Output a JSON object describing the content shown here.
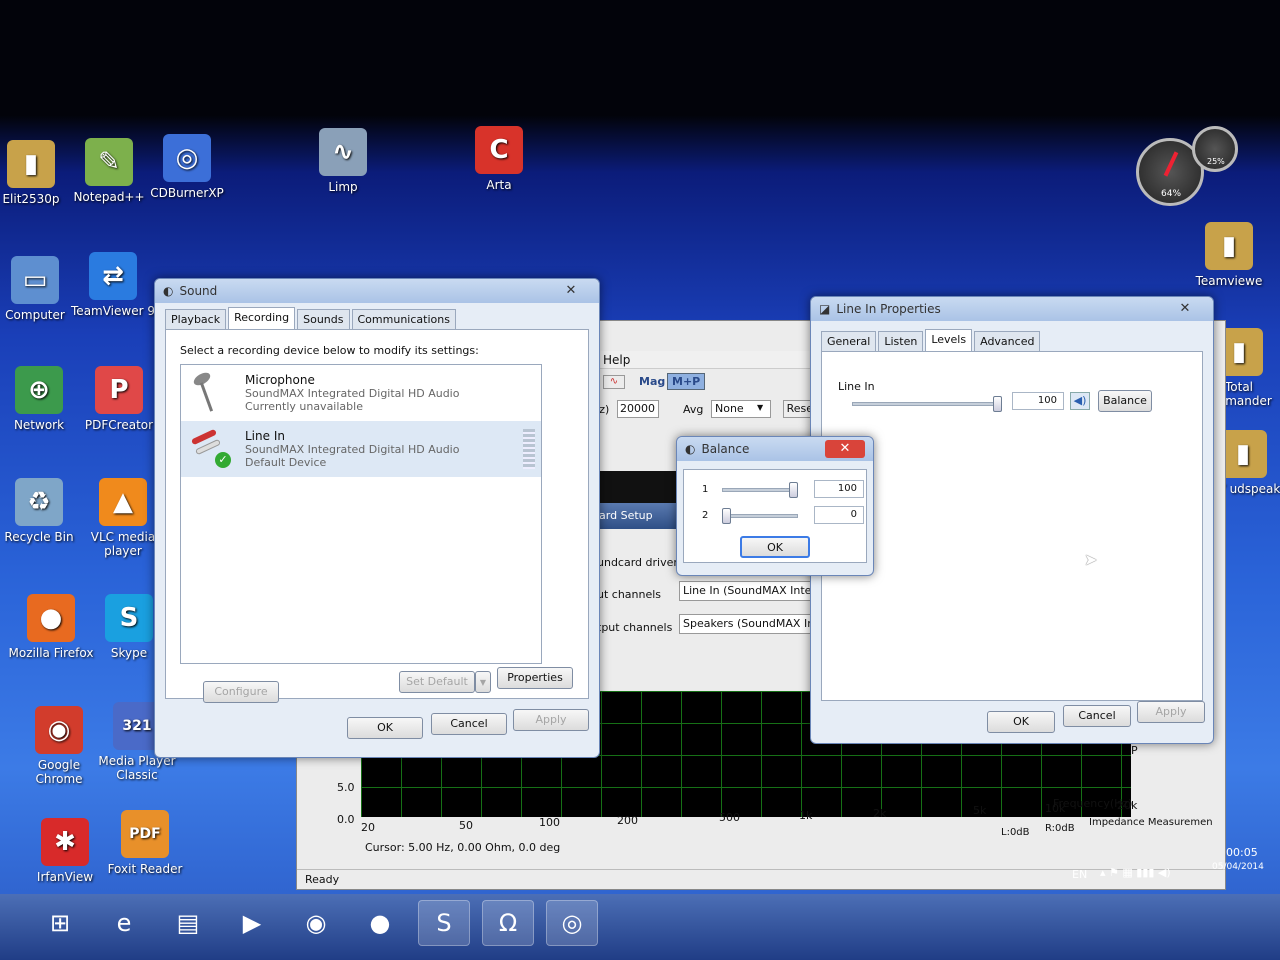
{
  "desktop": {
    "icons": [
      {
        "label": "Elit2530p",
        "glyph": "▮",
        "color": "#c8a24a"
      },
      {
        "label": "Notepad++",
        "glyph": "✎",
        "color": "#7db04c"
      },
      {
        "label": "CDBurnerXP",
        "glyph": "◎",
        "color": "#3c6fd8"
      },
      {
        "label": "Limp",
        "glyph": "∿",
        "color": "#8aa0b8"
      },
      {
        "label": "Arta",
        "glyph": "C",
        "color": "#d8332a"
      },
      {
        "label": "Computer",
        "glyph": "▭",
        "color": "#5e8fd0"
      },
      {
        "label": "TeamViewer 9",
        "glyph": "⇄",
        "color": "#2a7be0"
      },
      {
        "label": "Network",
        "glyph": "⊕",
        "color": "#3c9a4c"
      },
      {
        "label": "PDFCreator",
        "glyph": "P",
        "color": "#e04848"
      },
      {
        "label": "Recycle Bin",
        "glyph": "♻",
        "color": "#7fa6c8"
      },
      {
        "label": "VLC media player",
        "glyph": "▲",
        "color": "#f08a1c"
      },
      {
        "label": "Mozilla Firefox",
        "glyph": "●",
        "color": "#e86a20"
      },
      {
        "label": "Skype",
        "glyph": "S",
        "color": "#1aa0e0"
      },
      {
        "label": "Google Chrome",
        "glyph": "◉",
        "color": "#d23c2c"
      },
      {
        "label": "Media Player Classic",
        "glyph": "321",
        "color": "#4a6ac8"
      },
      {
        "label": "IrfanView",
        "glyph": "✱",
        "color": "#d82a2a"
      },
      {
        "label": "Foxit Reader",
        "glyph": "PDF",
        "color": "#e8902a"
      },
      {
        "label": "Teamviewe",
        "glyph": "▮",
        "color": "#c8a24a"
      },
      {
        "label": "Total ommander",
        "glyph": "▮",
        "color": "#c8a24a"
      },
      {
        "label": "DIY udspeak",
        "glyph": "▮",
        "color": "#c8a24a"
      }
    ]
  },
  "background_app": {
    "menu_help": "Help",
    "mag_button": "Mag",
    "mp_button": "M+P",
    "hz_label": "Hz)",
    "hz_value": "20000",
    "avg_label": "Avg",
    "avg_value": "None",
    "reset_button": "Reset",
    "card_setup": "card Setup",
    "soundcard_driver": "undcard driver",
    "input_channels_label": "ut channels",
    "input_channels_value": "Line In (SoundMAX Integrate",
    "output_channels_label": "tput channels",
    "output_channels_value": "Speakers (SoundMAX Integra",
    "y_ticks": [
      "5.0",
      "0.0"
    ],
    "x_ticks": [
      "20",
      "50",
      "100",
      "200",
      "500",
      "1k",
      "2k",
      "5k",
      "10k",
      "20k"
    ],
    "freq_label": "Frequency(Hz)",
    "cursor_text": "Cursor: 5.00 Hz, 0.00 Ohm, 0.0 deg",
    "l_level": "L:0dB",
    "r_level": "R:0dB",
    "mode_label": "Impedance Measuremen",
    "mp_side": "M P",
    "status": "Ready"
  },
  "sound_dialog": {
    "title": "Sound",
    "tabs": [
      "Playback",
      "Recording",
      "Sounds",
      "Communications"
    ],
    "instruction": "Select a recording device below to modify its settings:",
    "devices": [
      {
        "name": "Microphone",
        "driver": "SoundMAX Integrated Digital HD Audio",
        "status": "Currently unavailable"
      },
      {
        "name": "Line In",
        "driver": "SoundMAX Integrated Digital HD Audio",
        "status": "Default Device"
      }
    ],
    "configure": "Configure",
    "set_default": "Set Default",
    "properties": "Properties",
    "ok": "OK",
    "cancel": "Cancel",
    "apply": "Apply"
  },
  "balance_dialog": {
    "title": "Balance",
    "channels": [
      {
        "label": "1",
        "value": "100",
        "level": 1.0
      },
      {
        "label": "2",
        "value": "0",
        "level": 0.0
      }
    ],
    "ok": "OK"
  },
  "line_in_props": {
    "title": "Line In Properties",
    "tabs": [
      "General",
      "Listen",
      "Levels",
      "Advanced"
    ],
    "level_label": "Line In",
    "level_value": "100",
    "level_fraction": 1.0,
    "balance": "Balance",
    "ok": "OK",
    "cancel": "Cancel",
    "apply": "Apply"
  },
  "taskbar": {
    "items": [
      {
        "glyph": "⊞",
        "name": "start-icon"
      },
      {
        "glyph": "e",
        "name": "ie-icon"
      },
      {
        "glyph": "▤",
        "name": "explorer-icon"
      },
      {
        "glyph": "▶",
        "name": "media-icon"
      },
      {
        "glyph": "◉",
        "name": "chrome-icon"
      },
      {
        "glyph": "●",
        "name": "firefox-icon"
      },
      {
        "glyph": "S",
        "name": "skype-icon"
      },
      {
        "glyph": "Ω",
        "name": "omega-icon"
      },
      {
        "glyph": "◎",
        "name": "cd-icon"
      }
    ],
    "lang": "EN",
    "time": "00:05",
    "date": "05/04/2014"
  },
  "gadget": {
    "cpu": "64%",
    "mem": "25%"
  },
  "colors": {
    "accent": "#3c7be6",
    "selection": "#dde8f5",
    "plot_bg": "#000000",
    "grid": "#1c8c1c"
  }
}
